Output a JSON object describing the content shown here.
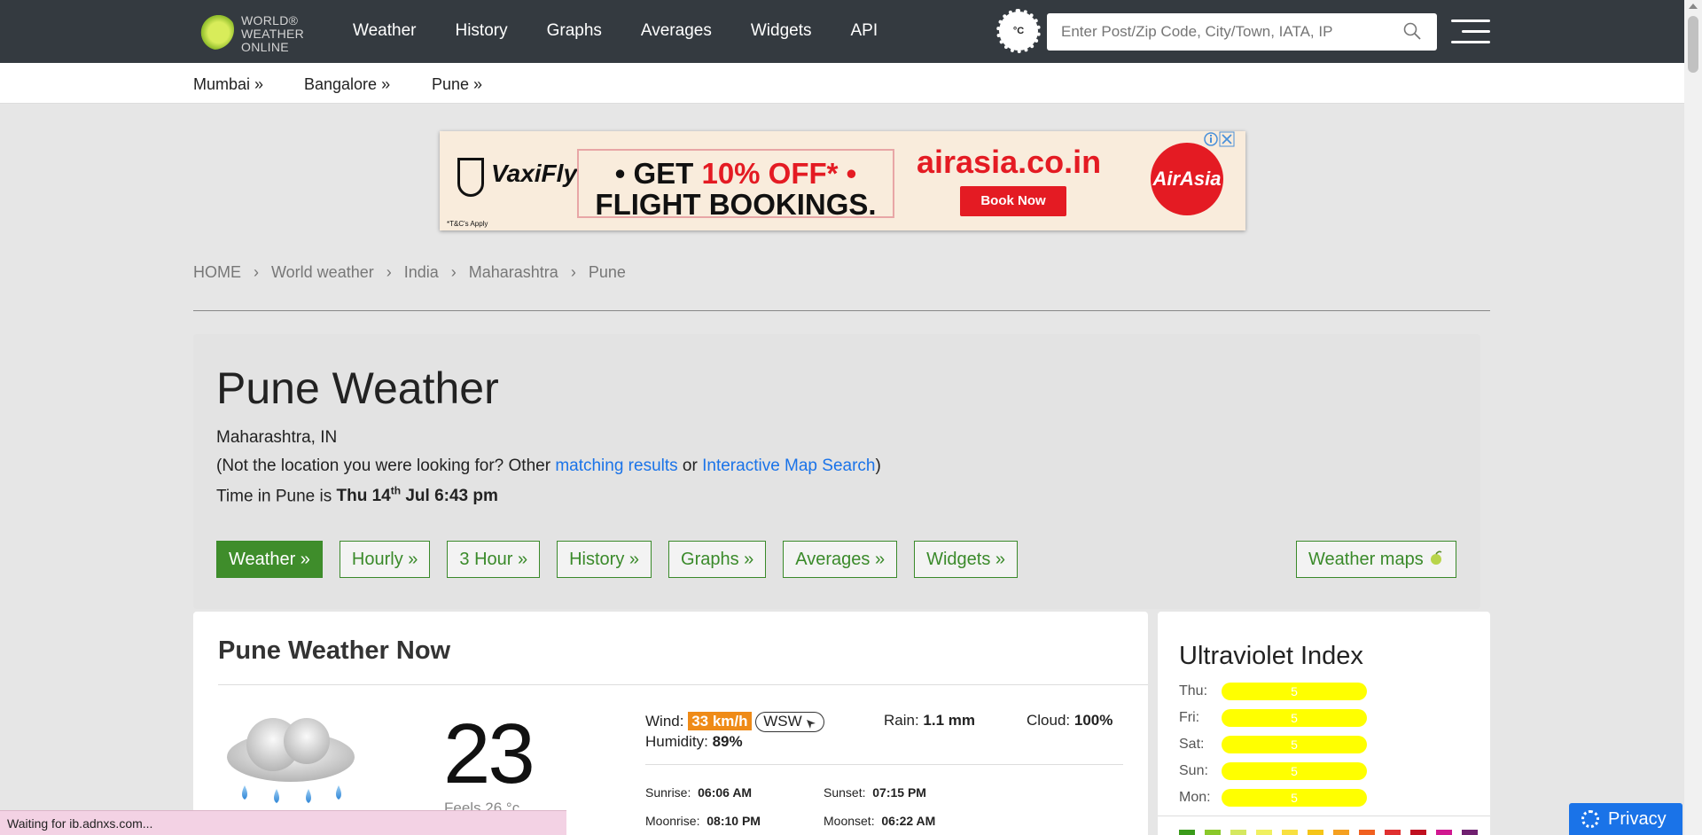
{
  "header": {
    "logo_line1": "WORLD®",
    "logo_line2": "WEATHER",
    "logo_line3": "ONLINE",
    "nav": [
      "Weather",
      "History",
      "Graphs",
      "Averages",
      "Widgets",
      "API"
    ],
    "unit_label": "°C",
    "search_placeholder": "Enter Post/Zip Code, City/Town, IATA, IP"
  },
  "subnav": [
    "Mumbai »",
    "Bangalore »",
    "Pune »"
  ],
  "ad": {
    "brand": "VaxiFly",
    "offer_line1_a": "• GET ",
    "offer_line1_b": "10% OFF",
    "offer_line1_c": "* •",
    "offer_line2": "FLIGHT BOOKINGS.",
    "site": "airasia.co.in",
    "cta": "Book Now",
    "logo_text": "AirAsia",
    "terms": "*T&C's Apply"
  },
  "breadcrumb": [
    "HOME",
    "World weather",
    "India",
    "Maharashtra",
    "Pune"
  ],
  "location": {
    "title": "Pune Weather",
    "region": "Maharashtra, IN",
    "not_location_prefix": "(Not the location you were looking for? Other ",
    "matching_link": "matching results",
    "or_text": " or ",
    "map_link": "Interactive Map Search",
    "close_paren": ")",
    "time_prefix": "Time in Pune is ",
    "time_day": "Thu 14",
    "time_suffix": "th",
    "time_rest": " Jul 6:43 pm"
  },
  "tabs": [
    "Weather »",
    "Hourly »",
    "3 Hour »",
    "History »",
    "Graphs »",
    "Averages »",
    "Widgets »"
  ],
  "weather_maps_label": "Weather maps",
  "now": {
    "heading": "Pune Weather Now",
    "temperature": "23",
    "feels_like": "Feels 26 °c",
    "wind_label": "Wind:",
    "wind_value": "33 km/h",
    "wind_dir": "WSW",
    "rain_label": "Rain:",
    "rain_value": "1.1 mm",
    "cloud_label": "Cloud:",
    "cloud_value": "100%",
    "humidity_label": "Humidity:",
    "humidity_value": "89%",
    "sunrise_label": "Sunrise:",
    "sunrise_value": "06:06 AM",
    "sunset_label": "Sunset:",
    "sunset_value": "07:15 PM",
    "moonrise_label": "Moonrise:",
    "moonrise_value": "08:10 PM",
    "moonset_label": "Moonset:",
    "moonset_value": "06:22 AM"
  },
  "uv": {
    "heading": "Ultraviolet Index",
    "rows": [
      {
        "day": "Thu:",
        "value": "5"
      },
      {
        "day": "Fri:",
        "value": "5"
      },
      {
        "day": "Sat:",
        "value": "5"
      },
      {
        "day": "Sun:",
        "value": "5"
      },
      {
        "day": "Mon:",
        "value": "5"
      }
    ],
    "bar_color": "#ffff00",
    "scale_colors": [
      "#3a9a1a",
      "#8ac82a",
      "#d5e860",
      "#f0f060",
      "#f8e040",
      "#f5c518",
      "#f5a020",
      "#f06020",
      "#e03030",
      "#c01020",
      "#d01890",
      "#702070"
    ]
  },
  "status_text": "Waiting for ib.adnxs.com...",
  "privacy_label": "Privacy"
}
